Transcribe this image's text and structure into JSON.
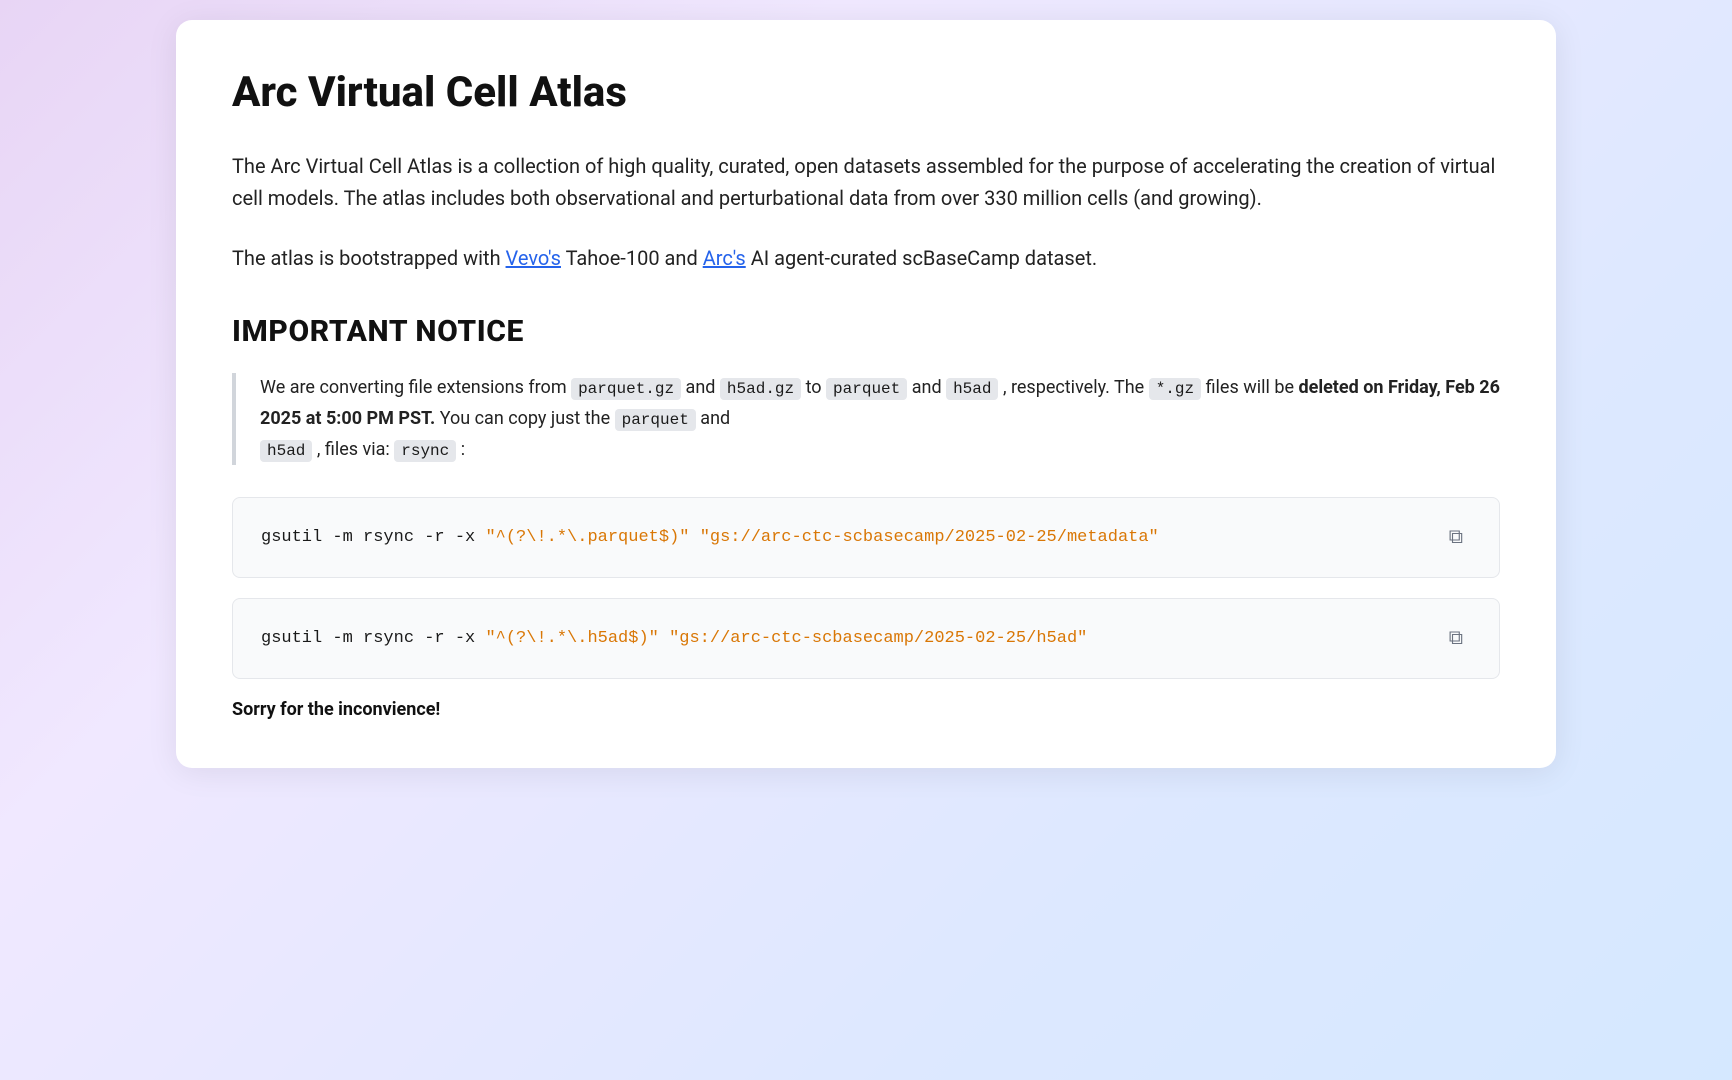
{
  "page": {
    "title": "Arc Virtual Cell Atlas",
    "description": "The Arc Virtual Cell Atlas is a collection of high quality, curated, open datasets assembled for the purpose of accelerating the creation of virtual cell models. The atlas includes both observational and perturbational data from over 330 million cells (and growing).",
    "bootstrap_line_prefix": "The atlas is bootstrapped with ",
    "vevo_link": "Vevo's",
    "bootstrap_middle": " Tahoe-100 and ",
    "arc_link": "Arc's",
    "bootstrap_suffix": " AI agent-curated scBaseCamp dataset.",
    "important_notice_title": "IMPORTANT NOTICE",
    "notice_text_prefix": "We are converting file extensions from ",
    "code_parquet_gz": "parquet.gz",
    "notice_and1": " and ",
    "code_h5ad_gz": "h5ad.gz",
    "notice_to": " to ",
    "code_parquet": "parquet",
    "notice_and2": " and ",
    "code_h5ad_inline": "h5ad",
    "notice_respectively": " , respectively. The ",
    "code_gz_wildcard": "*.gz",
    "notice_delete": " files will be ",
    "bold_delete": "deleted on Friday, Feb 26 2025 at 5:00 PM PST.",
    "notice_copy_prefix": " You can copy just the ",
    "code_parquet_plain": "parquet",
    "notice_and3": " and",
    "code_h5ad_plain": "h5ad",
    "notice_via": " , files via: ",
    "code_rsync": "rsync",
    "notice_colon": " :",
    "code_block_1": "gsutil -m rsync -r -x ",
    "code_block_1_string1": "\"^(?\\!.*\\.parquet$)\"",
    "code_block_1_space": " ",
    "code_block_1_string2": "\"gs://arc-ctc-scbasecamp/2025-02-25/metadata\"",
    "code_block_2": "gsutil -m rsync -r -x ",
    "code_block_2_string1": "\"^(?\\!.*\\.h5ad$)\"",
    "code_block_2_space": " ",
    "code_block_2_string2": "\"gs://arc-ctc-scbasecamp/2025-02-25/h5ad\"",
    "sorry_text": "Sorry for the inconvience!",
    "copy_icon": "⧉",
    "vevo_url": "#",
    "arc_url": "#"
  }
}
